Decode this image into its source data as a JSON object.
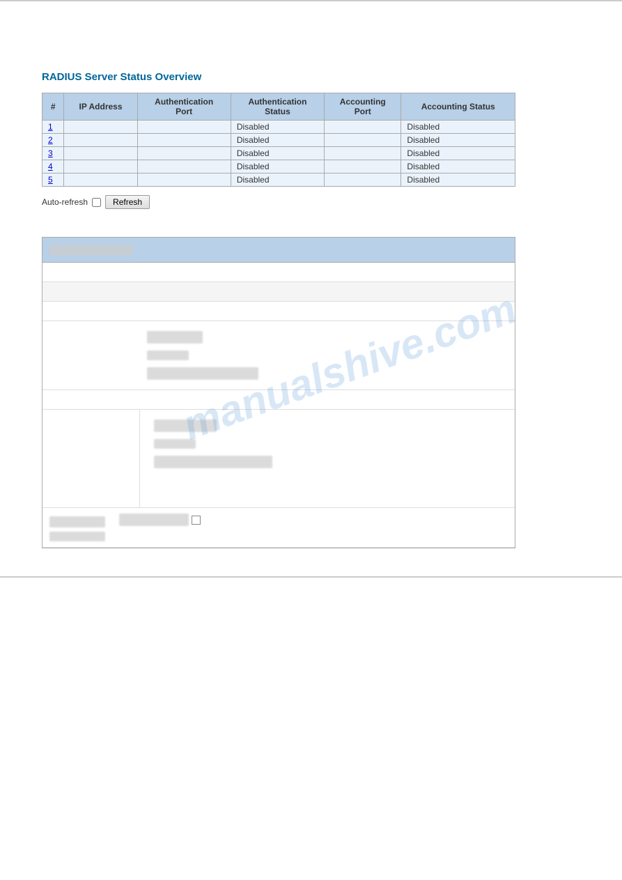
{
  "page": {
    "title": "RADIUS Server Status Overview",
    "watermark": "manualshive.com"
  },
  "table": {
    "columns": [
      {
        "id": "num",
        "label": "#"
      },
      {
        "id": "ip",
        "label": "IP Address"
      },
      {
        "id": "auth_port",
        "label": "Authentication Port"
      },
      {
        "id": "auth_status",
        "label": "Authentication Status"
      },
      {
        "id": "acct_port",
        "label": "Accounting Port"
      },
      {
        "id": "acct_status",
        "label": "Accounting Status"
      }
    ],
    "rows": [
      {
        "num": "1",
        "ip": "",
        "auth_port": "",
        "auth_status": "Disabled",
        "acct_port": "",
        "acct_status": "Disabled"
      },
      {
        "num": "2",
        "ip": "",
        "auth_port": "",
        "auth_status": "Disabled",
        "acct_port": "",
        "acct_status": "Disabled"
      },
      {
        "num": "3",
        "ip": "",
        "auth_port": "",
        "auth_status": "Disabled",
        "acct_port": "",
        "acct_status": "Disabled"
      },
      {
        "num": "4",
        "ip": "",
        "auth_port": "",
        "auth_status": "Disabled",
        "acct_port": "",
        "acct_status": "Disabled"
      },
      {
        "num": "5",
        "ip": "",
        "auth_port": "",
        "auth_status": "Disabled",
        "acct_port": "",
        "acct_status": "Disabled"
      }
    ]
  },
  "controls": {
    "auto_refresh_label": "Auto-refresh",
    "refresh_button_label": "Refresh"
  }
}
